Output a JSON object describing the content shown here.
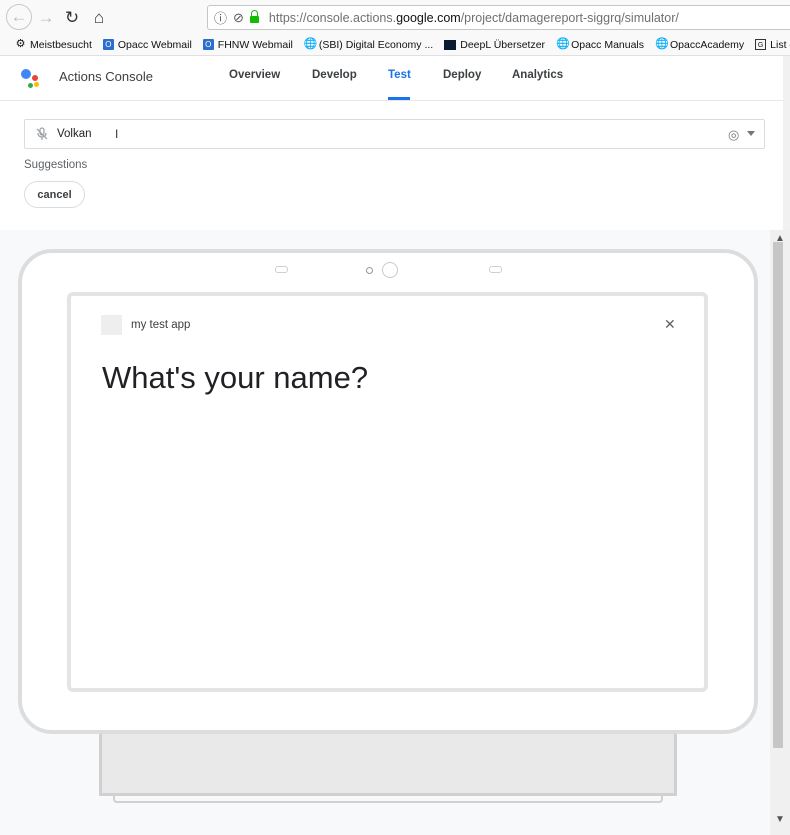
{
  "browser": {
    "url_prefix": "https://console.actions.",
    "url_domain": "google.com",
    "url_path": "/project/damagereport-siggrq/simulator/",
    "icons": [
      "back-arrow-icon",
      "forward-arrow-icon",
      "reload-icon",
      "home-icon",
      "info-icon",
      "tracking-icon",
      "lock-icon"
    ]
  },
  "bookmarks": [
    {
      "label": "Meistbesucht",
      "icon": "gear-icon"
    },
    {
      "label": "Opacc Webmail",
      "icon": "outlook-icon"
    },
    {
      "label": "FHNW Webmail",
      "icon": "outlook-icon"
    },
    {
      "label": "(SBI) Digital Economy ...",
      "icon": "globe-icon"
    },
    {
      "label": "DeepL Übersetzer",
      "icon": "deepl-icon"
    },
    {
      "label": "Opacc Manuals",
      "icon": "globe-icon"
    },
    {
      "label": "OpaccAcademy",
      "icon": "globe-icon"
    },
    {
      "label": "List of SQL Com",
      "icon": "document-icon"
    }
  ],
  "header": {
    "title": "Actions Console",
    "tabs": [
      {
        "label": "Overview",
        "active": false
      },
      {
        "label": "Develop",
        "active": false
      },
      {
        "label": "Test",
        "active": true
      },
      {
        "label": "Deploy",
        "active": false
      },
      {
        "label": "Analytics",
        "active": false
      }
    ]
  },
  "simulator": {
    "input_value": "Volkan",
    "suggestions_label": "Suggestions",
    "suggestions": [
      "cancel"
    ],
    "device": {
      "app_name": "my test app",
      "prompt": "What's your name?"
    }
  },
  "colors": {
    "accent": "#1a73e8",
    "google_blue": "#4285f4",
    "google_red": "#ea4335",
    "google_yellow": "#fbbc05",
    "google_green": "#34a853"
  }
}
